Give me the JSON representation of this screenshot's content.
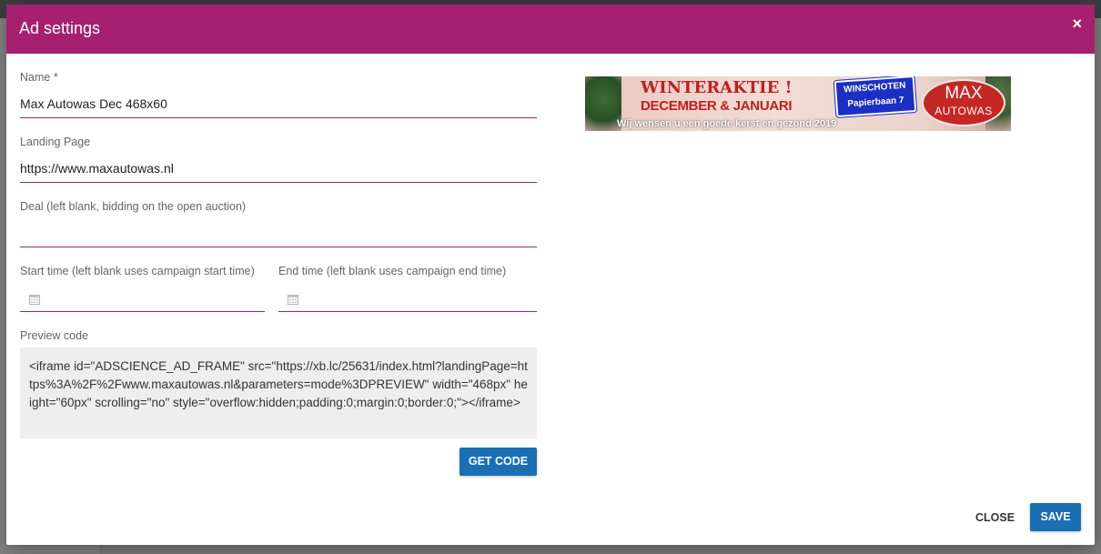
{
  "dialog": {
    "title": "Ad settings",
    "close_icon": "×",
    "accent_color": "#a5206e",
    "primary_color": "#1a6fb4"
  },
  "form": {
    "name": {
      "label": "Name *",
      "value": "Max Autowas Dec 468x60"
    },
    "landing_page": {
      "label": "Landing Page",
      "value": "https://www.maxautowas.nl"
    },
    "deal": {
      "label": "Deal (left blank, bidding on the open auction)",
      "value": ""
    },
    "start_time": {
      "label": "Start time (left blank uses campaign start time)",
      "value": "",
      "icon": "calendar-icon"
    },
    "end_time": {
      "label": "End time (left blank uses campaign end time)",
      "value": "",
      "icon": "calendar-icon"
    },
    "preview_code": {
      "label": "Preview code",
      "value": "<iframe id=\"ADSCIENCE_AD_FRAME\" src=\"https://xb.lc/25631/index.html?landingPage=https%3A%2F%2Fwww.maxautowas.nl&parameters=mode%3DPREVIEW\" width=\"468px\" height=\"60px\" scrolling=\"no\" style=\"overflow:hidden;padding:0;margin:0;border:0;\"></iframe>"
    },
    "get_code_button": "GET CODE"
  },
  "banner": {
    "headline": "WINTERAKTIE !",
    "subheadline": "DECEMBER & JANUARI",
    "tagline": "Wij wensen u een goede kerst en gezond 2019",
    "sign_line1": "WINSCHOTEN",
    "sign_line2": "Papierbaan 7",
    "logo_line1": "MAX",
    "logo_line2": "AUTOWAS"
  },
  "footer": {
    "close_button": "CLOSE",
    "save_button": "SAVE"
  }
}
